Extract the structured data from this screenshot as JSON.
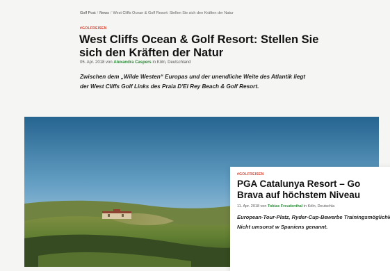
{
  "breadcrumb": {
    "home": "Golf Post",
    "section": "News",
    "current": "West Cliffs Ocean & Golf Resort: Stellen Sie sich den Kräften der Natur",
    "separator": "/"
  },
  "article": {
    "tag": "#GOLFREISEN",
    "title": "West Cliffs Ocean & Golf Resort: Stellen Sie sich den Kräften der Natur",
    "date": "05. Apr. 2018",
    "by": "von",
    "author": "Alexandra Caspers",
    "location": "in Köln, Deutschland",
    "lead": "Zwischen dem „Wilde Westen“ Europas und der unendliche Weite des Atlantik liegt der West Cliffs Golf Links des Praia D'El Rey Beach & Golf Resort."
  },
  "card": {
    "tag": "#GOLFREISEN",
    "title_line1": "PGA Catalunya Resort – Go",
    "title_line2": "Brava auf höchstem Niveau",
    "date": "11. Apr. 2018",
    "by": "von",
    "author": "Tobias Freudenthal",
    "location": "in Köln, Deutschla",
    "lead": "European-Tour-Platz, Ryder-Cup-Bewerbe Trainingsmöglichkeiten – Nicht umsonst w Spaniens genannt."
  },
  "colors": {
    "accent_tag": "#d43b2a",
    "author_link": "#2f8a3a",
    "background": "#f5f5f3"
  }
}
